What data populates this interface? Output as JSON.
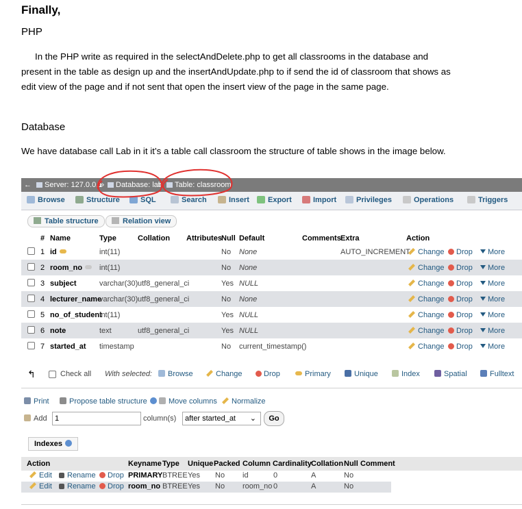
{
  "doc": {
    "heading": "Finally,",
    "php_heading": "PHP",
    "php_paragraph_1": "In the PHP write as required in the selectAndDelete.php to get all classrooms in the database and",
    "php_paragraph_2": "present in the table as design up and the insertAndUpdate.php to if send the id of classroom that shows as",
    "php_paragraph_3": "edit view of the page and if not sent that open the insert view of the page in the same page.",
    "db_heading": "Database",
    "db_paragraph": "We have database call Lab in it it’s a table call classroom the structure of table shows in the image below."
  },
  "pma": {
    "breadcrumb": {
      "server": "Server: 127.0.0.1",
      "database": "Database: lab",
      "table": "Table: classroom"
    },
    "tabs": [
      "Browse",
      "Structure",
      "SQL",
      "Search",
      "Insert",
      "Export",
      "Import",
      "Privileges",
      "Operations",
      "Triggers"
    ],
    "subtabs": [
      "Table structure",
      "Relation view"
    ],
    "columns": {
      "num": "#",
      "name": "Name",
      "type": "Type",
      "collation": "Collation",
      "attributes": "Attributes",
      "null": "Null",
      "default": "Default",
      "comments": "Comments",
      "extra": "Extra",
      "action": "Action"
    },
    "actions": {
      "change": "Change",
      "drop": "Drop",
      "more": "More"
    },
    "rows": [
      {
        "num": "1",
        "name": "id",
        "type": "int(11)",
        "collation": "",
        "null": "No",
        "default": "None",
        "extra": "AUTO_INCREMENT"
      },
      {
        "num": "2",
        "name": "room_no",
        "type": "int(11)",
        "collation": "",
        "null": "No",
        "default": "None",
        "extra": ""
      },
      {
        "num": "3",
        "name": "subject",
        "type": "varchar(30)",
        "collation": "utf8_general_ci",
        "null": "Yes",
        "default": "NULL",
        "extra": ""
      },
      {
        "num": "4",
        "name": "lecturer_name",
        "type": "varchar(30)",
        "collation": "utf8_general_ci",
        "null": "No",
        "default": "None",
        "extra": ""
      },
      {
        "num": "5",
        "name": "no_of_student",
        "type": "int(11)",
        "collation": "",
        "null": "Yes",
        "default": "NULL",
        "extra": ""
      },
      {
        "num": "6",
        "name": "note",
        "type": "text",
        "collation": "utf8_general_ci",
        "null": "Yes",
        "default": "NULL",
        "extra": ""
      },
      {
        "num": "7",
        "name": "started_at",
        "type": "timestamp",
        "collation": "",
        "null": "No",
        "default": "current_timestamp()",
        "extra": ""
      }
    ],
    "with_selected": {
      "check_all": "Check all",
      "label": "With selected:",
      "browse": "Browse",
      "change": "Change",
      "drop": "Drop",
      "primary": "Primary",
      "unique": "Unique",
      "index": "Index",
      "spatial": "Spatial",
      "fulltext": "Fulltext"
    },
    "tools": {
      "print": "Print",
      "propose": "Propose table structure",
      "move": "Move columns",
      "normalize": "Normalize"
    },
    "add": {
      "label": "Add",
      "value": "1",
      "unit": "column(s)",
      "position": "after started_at",
      "go": "Go"
    },
    "indexes": {
      "title": "Indexes",
      "headers": {
        "action": "Action",
        "keyname": "Keyname",
        "type": "Type",
        "unique": "Unique",
        "packed": "Packed",
        "column": "Column",
        "cardinality": "Cardinality",
        "collation": "Collation",
        "null": "Null",
        "comment": "Comment"
      },
      "edit": "Edit",
      "rename": "Rename",
      "drop": "Drop",
      "rows": [
        {
          "keyname": "PRIMARY",
          "type": "BTREE",
          "unique": "Yes",
          "packed": "No",
          "column": "id",
          "cardinality": "0",
          "collation": "A",
          "null": "No"
        },
        {
          "keyname": "room_no",
          "type": "BTREE",
          "unique": "Yes",
          "packed": "No",
          "column": "room_no",
          "cardinality": "0",
          "collation": "A",
          "null": "No"
        }
      ]
    }
  }
}
